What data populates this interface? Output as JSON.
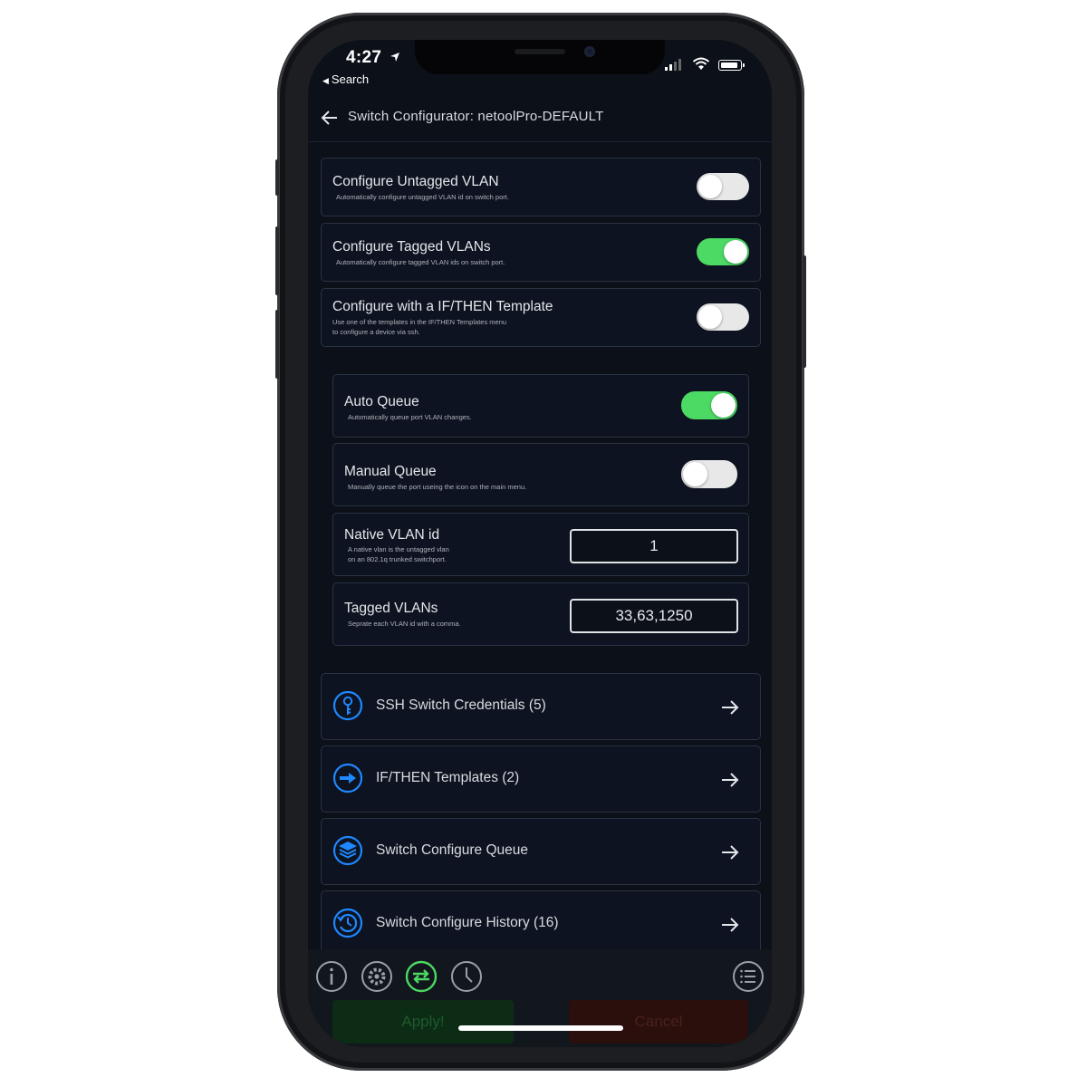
{
  "status_bar": {
    "time": "4:27",
    "back_app": "Search"
  },
  "navbar": {
    "title": "Switch Configurator: netoolPro-DEFAULT"
  },
  "settings": [
    {
      "title": "Configure Untagged VLAN",
      "subtitle": "Automatically configure untagged VLAN id on switch port.",
      "enabled": false
    },
    {
      "title": "Configure Tagged VLANs",
      "subtitle": "Automatically configure tagged VLAN ids on switch port.",
      "enabled": true
    },
    {
      "title": "Configure with a IF/THEN Template",
      "subtitle": "Use one of the templates in the IF/THEN Templates menu\nto configure a device via ssh.",
      "enabled": false
    }
  ],
  "queue": [
    {
      "title": "Auto Queue",
      "subtitle": "Automatically queue port VLAN changes.",
      "enabled": true
    },
    {
      "title": "Manual Queue",
      "subtitle": "Manually queue the port useing the icon on the main menu.",
      "enabled": false
    }
  ],
  "native_vlan": {
    "title": "Native VLAN id",
    "subtitle": "A native vlan is the untagged vlan\non an 802.1q trunked switchport.",
    "value": "1"
  },
  "tagged_vlans": {
    "title": "Tagged VLANs",
    "subtitle": "Seprate each VLAN id with a comma.",
    "value": "33,63,1250"
  },
  "links": [
    {
      "label": "SSH Switch Credentials (5)",
      "icon": "key-icon"
    },
    {
      "label": "IF/THEN Templates (2)",
      "icon": "arrow-circle-icon"
    },
    {
      "label": "Switch Configure Queue",
      "icon": "layers-icon"
    },
    {
      "label": "Switch Configure History (16)",
      "icon": "history-icon"
    }
  ],
  "tabbar": {
    "tabs": [
      "info-icon",
      "settings-icon",
      "switch-config-icon",
      "history-clock-icon",
      "menu-list-icon"
    ],
    "apply_label": "Apply!",
    "cancel_label": "Cancel"
  },
  "colors": {
    "toggle_on": "#4cd964",
    "accent_blue": "#1e88ff",
    "active_tab": "#4cd964",
    "background": "#0b1019"
  }
}
